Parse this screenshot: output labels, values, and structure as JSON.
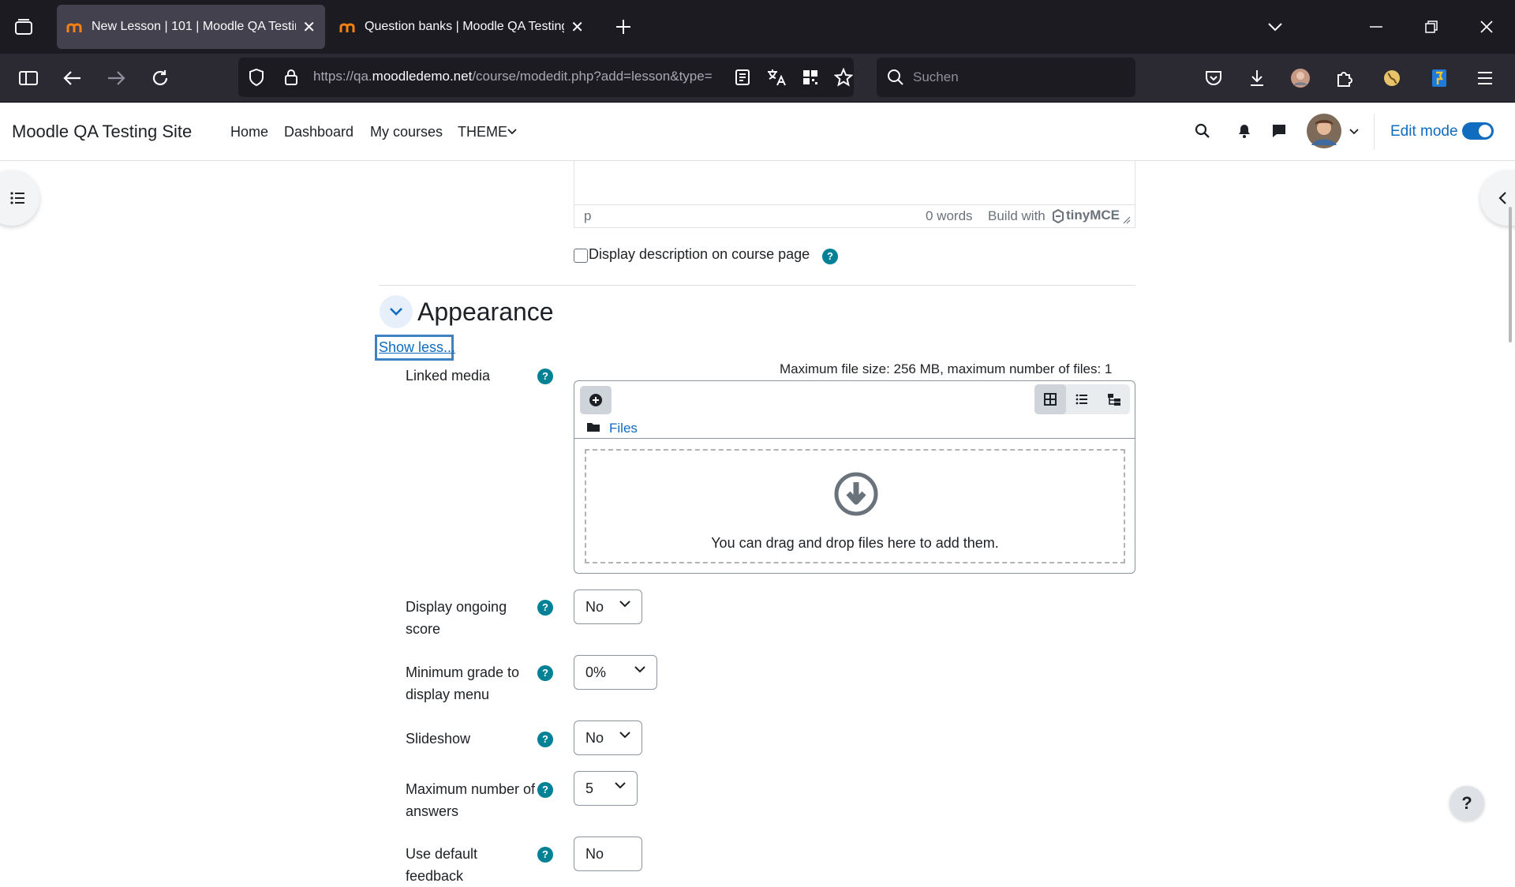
{
  "browser": {
    "tabs": [
      {
        "title": "New Lesson | 101 | Moodle QA Testing",
        "active": true
      },
      {
        "title": "Question banks | Moodle QA Testing Si",
        "active": false
      }
    ],
    "url_prefix": "https://qa.",
    "url_domain": "moodledemo.net",
    "url_path": "/course/modedit.php?add=lesson&type=",
    "search_placeholder": "Suchen"
  },
  "navbar": {
    "site_name": "Moodle QA Testing Site",
    "links": [
      "Home",
      "Dashboard",
      "My courses",
      "THEME"
    ],
    "edit_mode_label": "Edit mode",
    "edit_mode_on": true
  },
  "editor": {
    "path": "p",
    "word_count": "0 words",
    "build_with": "Build with",
    "brand": "tinyMCE"
  },
  "display_description": {
    "label": "Display description on course page",
    "checked": false
  },
  "section": {
    "title": "Appearance",
    "show_less": "Show less..."
  },
  "linked_media": {
    "label": "Linked media",
    "limits": "Maximum file size: 256 MB, maximum number of files: 1",
    "folder": "Files",
    "drop_text": "You can drag and drop files here to add them."
  },
  "fields": [
    {
      "label": "Display ongoing score",
      "value": "No"
    },
    {
      "label": "Minimum grade to display menu",
      "value": "0%"
    },
    {
      "label": "Slideshow",
      "value": "No"
    },
    {
      "label": "Maximum number of answers",
      "value": "5"
    },
    {
      "label": "Use default feedback",
      "value": "No"
    }
  ],
  "help_button": "?",
  "colors": {
    "accent": "#0f6cbf",
    "help": "#008196",
    "browser_bg": "#1c1b22"
  }
}
